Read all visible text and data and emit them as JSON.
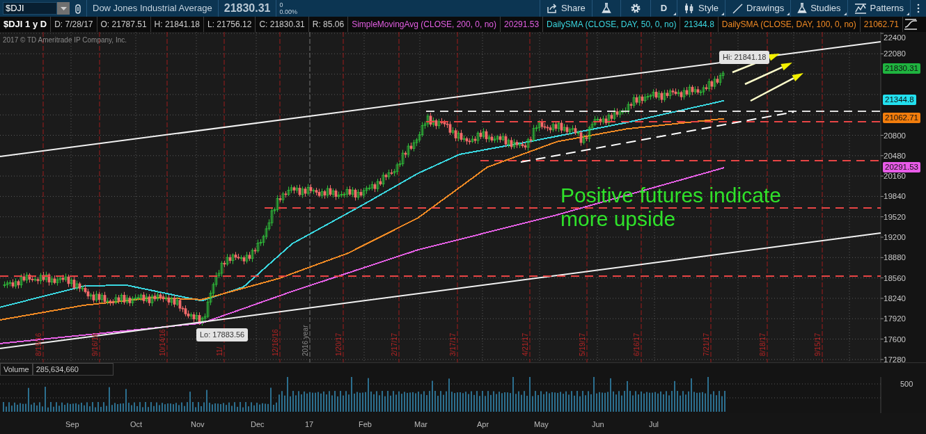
{
  "toolbar": {
    "symbol": "$DJI",
    "description": "Dow Jones Industrial Average",
    "last_price": "21830.31",
    "change": "0",
    "change_percent": "0.00%",
    "buttons": [
      {
        "kind": "share",
        "label": "Share"
      },
      {
        "kind": "flask"
      },
      {
        "kind": "gear"
      },
      {
        "kind": "period",
        "label": "D"
      },
      {
        "kind": "style",
        "label": "Style"
      },
      {
        "kind": "drawings",
        "label": "Drawings"
      },
      {
        "kind": "studies",
        "label": "Studies"
      },
      {
        "kind": "patterns",
        "label": "Patterns"
      },
      {
        "kind": "more"
      }
    ]
  },
  "info_bar": {
    "title": "$DJI 1 y D",
    "fields": [
      "D: 7/28/17",
      "O: 21787.51",
      "H: 21841.18",
      "L: 21756.12",
      "C: 21830.31",
      "R: 85.06"
    ],
    "studies": [
      {
        "name": "SimpleMovingAvg (CLOSE, 200, 0, no)",
        "value": "20291.53",
        "color": "#e35fe3"
      },
      {
        "name": "DailySMA (CLOSE, DAY, 50, 0, no)",
        "value": "21344.8",
        "color": "#3ad7e0"
      },
      {
        "name": "DailySMA (CLOSE, DAY, 100, 0, no)",
        "value": "21062.71",
        "color": "#f08a24"
      }
    ]
  },
  "chart": {
    "copyright": "2017 © TD Ameritrade IP Company, Inc.",
    "price_ticks": [
      "22400",
      "22080",
      "20800",
      "20480",
      "20160",
      "19840",
      "19520",
      "19200",
      "18880",
      "18560",
      "18240",
      "17920",
      "17600",
      "17280"
    ],
    "price_tags": [
      {
        "label": "21830.31",
        "color": "#1fb43f"
      },
      {
        "label": "21344.8",
        "color": "#22e0ef"
      },
      {
        "label": "21062.71",
        "color": "#f27d0c"
      },
      {
        "label": "20291.53",
        "color": "#e85be8"
      }
    ],
    "date_markers": [
      "8/19/16",
      "9/16/16",
      "10/14/16",
      "11/",
      "12/16/16",
      "1/20/17",
      "2/17/17",
      "3/17/17",
      "4/21/17",
      "5/19/17",
      "6/16/17",
      "7/21/17",
      "8/18/17",
      "9/15/17"
    ],
    "year_marker": "2016 year",
    "high_label": "Hi: 21841.18",
    "low_label": "Lo: 17883.56",
    "annotation": "Positive futures indicate more upside"
  },
  "volume": {
    "title": "Volume",
    "value": "285,634,660",
    "tick": "500"
  },
  "months": [
    "Sep",
    "Oct",
    "Nov",
    "Dec",
    "17",
    "Feb",
    "Mar",
    "Apr",
    "May",
    "Jun",
    "Jul"
  ]
}
